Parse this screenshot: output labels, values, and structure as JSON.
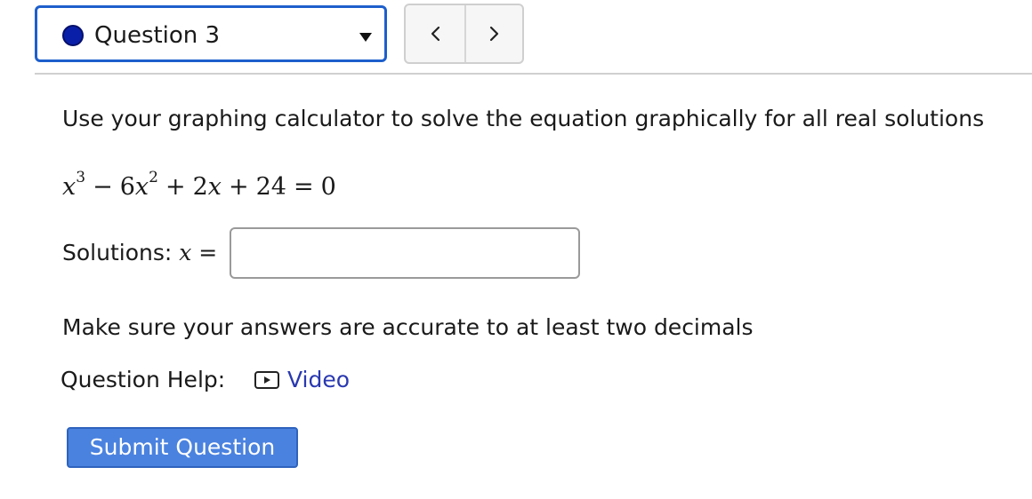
{
  "question_selector": {
    "label": "Question 3",
    "status_color": "#0a1fa8",
    "caret_icon": "caret-down-icon"
  },
  "nav": {
    "prev_icon": "chevron-left-icon",
    "next_icon": "chevron-right-icon"
  },
  "question": {
    "prompt": "Use your graphing calculator to solve the equation graphically for all real solutions",
    "equation": {
      "t1_var": "x",
      "t1_exp": "3",
      "op1": "−",
      "t2_coef": "6",
      "t2_var": "x",
      "t2_exp": "2",
      "op2": "+",
      "t3": "2",
      "t3_var": "x",
      "op3": "+",
      "t4": "24",
      "eq": "=",
      "rhs": "0"
    },
    "solutions_label": "Solutions: ",
    "solutions_var": "x",
    "solutions_eq": " =",
    "answer_value": "",
    "hint": "Make sure your answers are accurate to at least two decimals"
  },
  "help": {
    "label": "Question Help:",
    "video_label": "Video",
    "video_icon": "play-video-icon",
    "link_color": "#2a39b0"
  },
  "submit": {
    "label": "Submit Question",
    "color": "#4a82df"
  }
}
